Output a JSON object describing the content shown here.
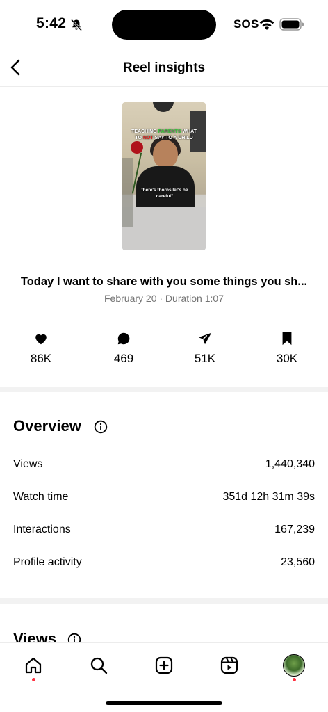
{
  "status_bar": {
    "time": "5:42",
    "sos": "SOS",
    "icons": [
      "bell-slash-icon",
      "wifi-icon",
      "battery-icon"
    ]
  },
  "header": {
    "title": "Reel insights",
    "back_icon": "chevron-left-icon"
  },
  "reel": {
    "thumbnail_caption_parts": [
      "TEACHING ",
      "PARENTS",
      " WHAT ",
      "TO ",
      "NOT",
      " SAY TO A CHILD"
    ],
    "thumbnail_subtitle": "there's thorns let's be careful\"",
    "title": "Today I want to share with you some things you sh...",
    "meta": "February 20 · Duration 1:07"
  },
  "stats": [
    {
      "icon": "heart-icon",
      "value": "86K"
    },
    {
      "icon": "comment-icon",
      "value": "469"
    },
    {
      "icon": "share-icon",
      "value": "51K"
    },
    {
      "icon": "bookmark-icon",
      "value": "30K"
    }
  ],
  "overview": {
    "heading": "Overview",
    "metrics": [
      {
        "label": "Views",
        "value": "1,440,340"
      },
      {
        "label": "Watch time",
        "value": "351d 12h 31m 39s"
      },
      {
        "label": "Interactions",
        "value": "167,239"
      },
      {
        "label": "Profile activity",
        "value": "23,560"
      }
    ]
  },
  "views_section": {
    "heading": "Views"
  },
  "tab_bar": {
    "tabs": [
      "home-icon",
      "search-icon",
      "create-icon",
      "reels-icon",
      "profile-avatar"
    ]
  },
  "colors": {
    "notification_dot": "#ff3040",
    "secondary_text": "#737373",
    "divider": "#f2f2f2"
  }
}
